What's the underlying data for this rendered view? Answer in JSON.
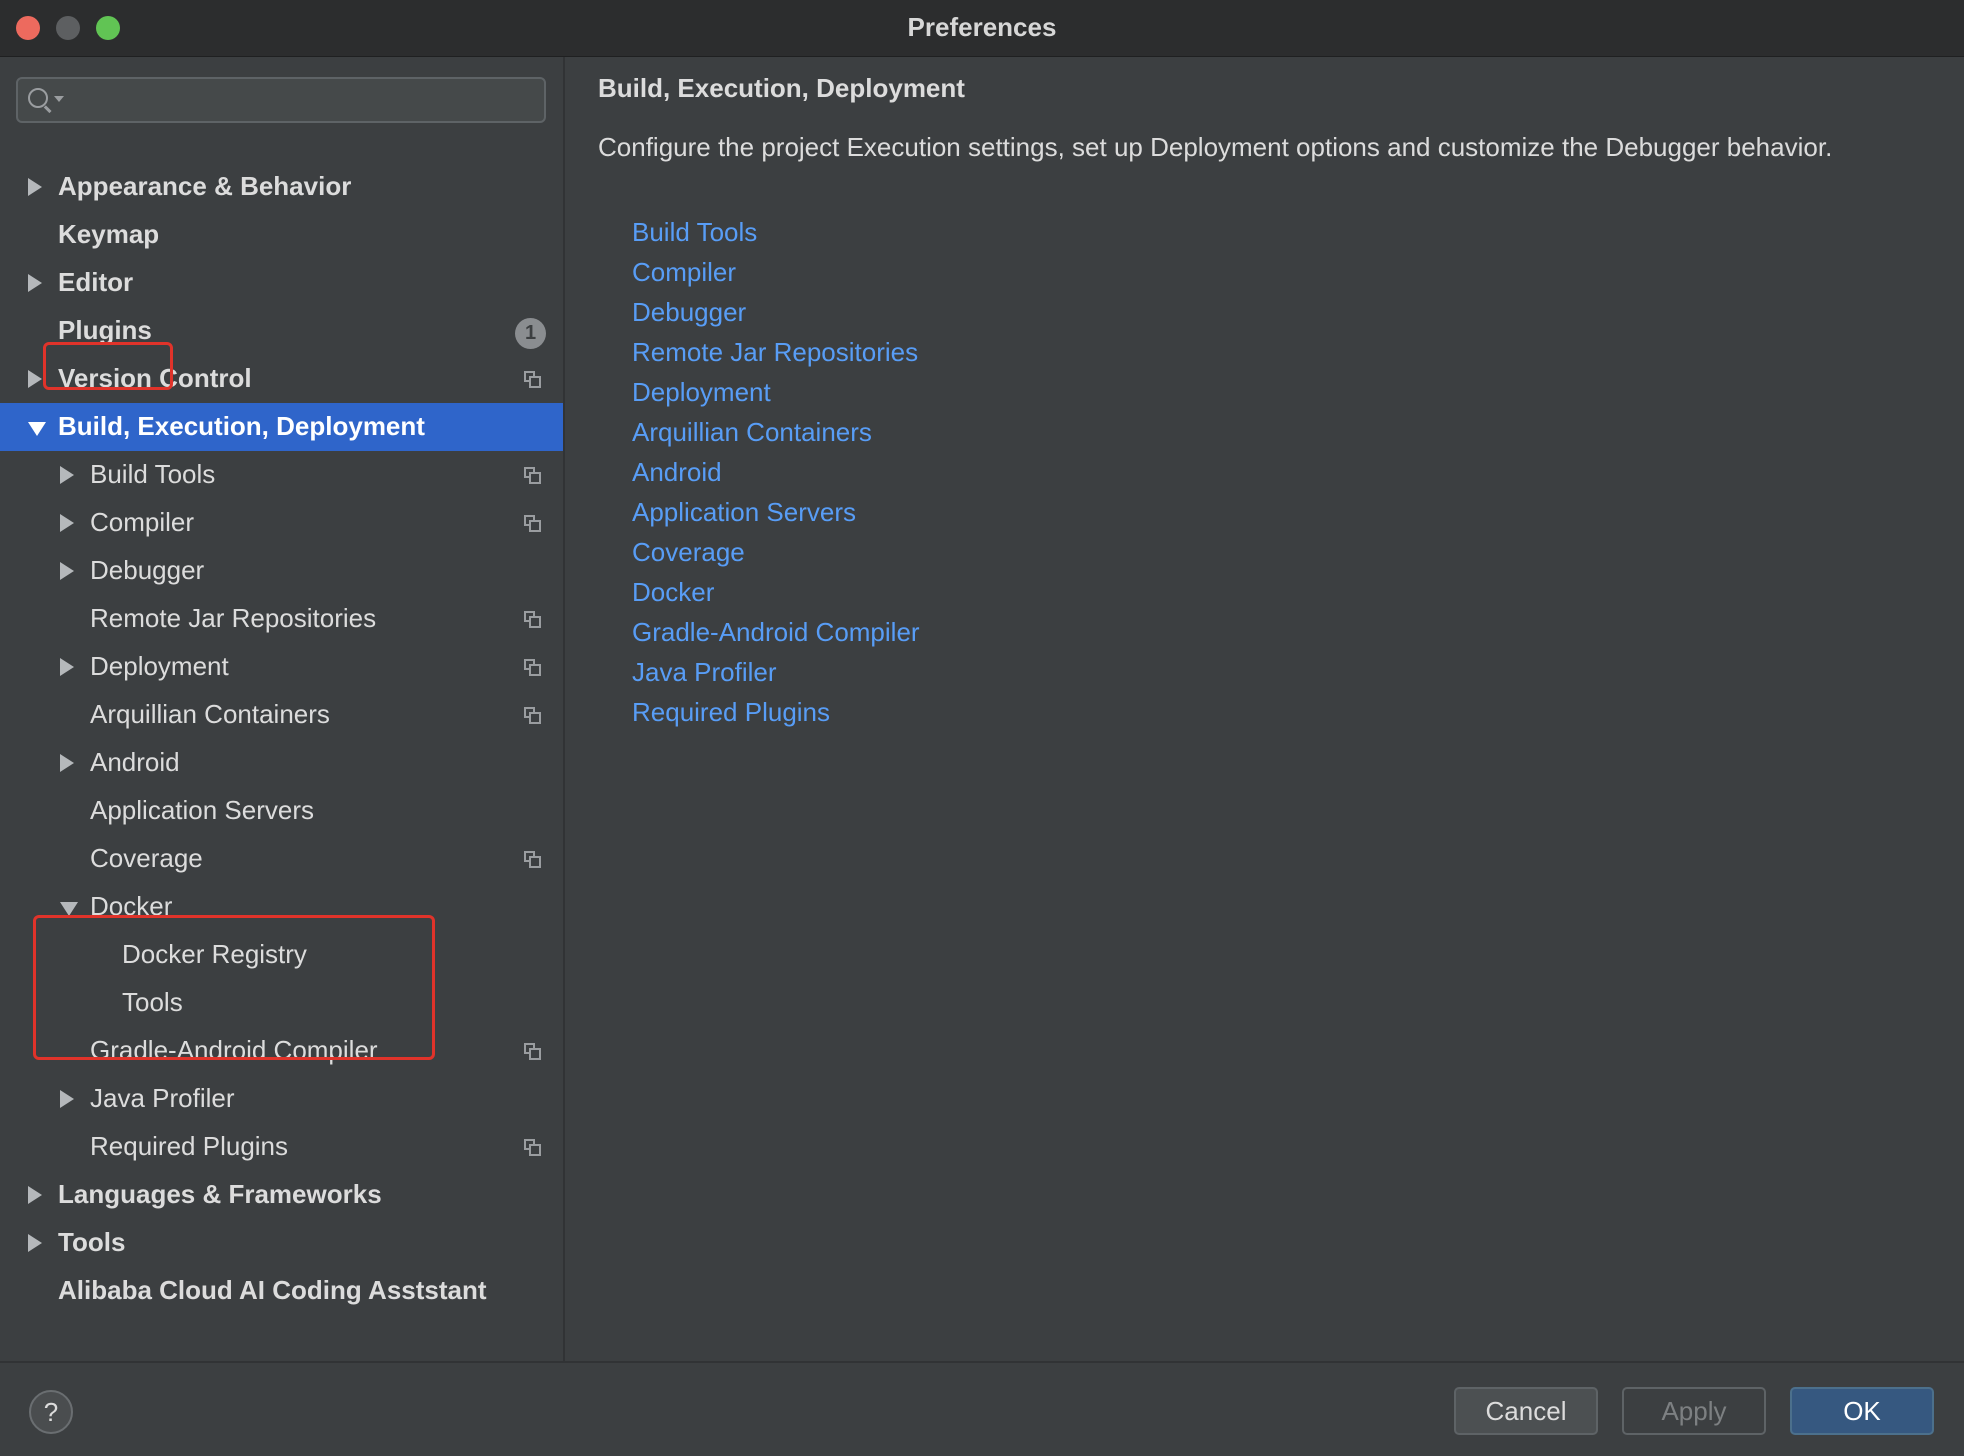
{
  "window": {
    "title": "Preferences"
  },
  "search": {
    "placeholder": ""
  },
  "sidebar": {
    "items": [
      {
        "label": "Appearance & Behavior",
        "expandable": true,
        "expanded": false,
        "bold": true,
        "level": 0
      },
      {
        "label": "Keymap",
        "expandable": false,
        "bold": true,
        "level": 0
      },
      {
        "label": "Editor",
        "expandable": true,
        "expanded": false,
        "bold": true,
        "level": 0
      },
      {
        "label": "Plugins",
        "expandable": false,
        "bold": true,
        "level": 0,
        "badge": "1",
        "highlighted": true
      },
      {
        "label": "Version Control",
        "expandable": true,
        "expanded": false,
        "bold": true,
        "level": 0,
        "project_icon": true
      },
      {
        "label": "Build, Execution, Deployment",
        "expandable": true,
        "expanded": true,
        "bold": true,
        "level": 0,
        "selected": true
      },
      {
        "label": "Build Tools",
        "expandable": true,
        "expanded": false,
        "level": 1,
        "project_icon": true
      },
      {
        "label": "Compiler",
        "expandable": true,
        "expanded": false,
        "level": 1,
        "project_icon": true
      },
      {
        "label": "Debugger",
        "expandable": true,
        "expanded": false,
        "level": 1
      },
      {
        "label": "Remote Jar Repositories",
        "expandable": false,
        "level": 1,
        "project_icon": true
      },
      {
        "label": "Deployment",
        "expandable": true,
        "expanded": false,
        "level": 1,
        "project_icon": true
      },
      {
        "label": "Arquillian Containers",
        "expandable": false,
        "level": 1,
        "project_icon": true
      },
      {
        "label": "Android",
        "expandable": true,
        "expanded": false,
        "level": 1
      },
      {
        "label": "Application Servers",
        "expandable": false,
        "level": 1
      },
      {
        "label": "Coverage",
        "expandable": false,
        "level": 1,
        "project_icon": true
      },
      {
        "label": "Docker",
        "expandable": true,
        "expanded": true,
        "level": 1,
        "highlighted": true
      },
      {
        "label": "Docker Registry",
        "expandable": false,
        "level": 2
      },
      {
        "label": "Tools",
        "expandable": false,
        "level": 2
      },
      {
        "label": "Gradle-Android Compiler",
        "expandable": false,
        "level": 1,
        "project_icon": true
      },
      {
        "label": "Java Profiler",
        "expandable": true,
        "expanded": false,
        "level": 1
      },
      {
        "label": "Required Plugins",
        "expandable": false,
        "level": 1,
        "project_icon": true
      },
      {
        "label": "Languages & Frameworks",
        "expandable": true,
        "expanded": false,
        "bold": true,
        "level": 0
      },
      {
        "label": "Tools",
        "expandable": true,
        "expanded": false,
        "bold": true,
        "level": 0
      },
      {
        "label": "Alibaba Cloud AI Coding Asststant",
        "expandable": false,
        "bold": true,
        "level": 0
      }
    ]
  },
  "main": {
    "title": "Build, Execution, Deployment",
    "description": "Configure the project Execution settings, set up Deployment options and customize the Debugger behavior.",
    "links": [
      "Build Tools",
      "Compiler",
      "Debugger",
      "Remote Jar Repositories",
      "Deployment",
      "Arquillian Containers",
      "Android",
      "Application Servers",
      "Coverage",
      "Docker",
      "Gradle-Android Compiler",
      "Java Profiler",
      "Required Plugins"
    ]
  },
  "footer": {
    "help_label": "?",
    "cancel_label": "Cancel",
    "apply_label": "Apply",
    "apply_enabled": false,
    "ok_label": "OK"
  },
  "colors": {
    "background": "#3c3f41",
    "selection": "#2f65ca",
    "link": "#589df6",
    "highlight_box": "#e0332a",
    "ok_button": "#365880"
  }
}
